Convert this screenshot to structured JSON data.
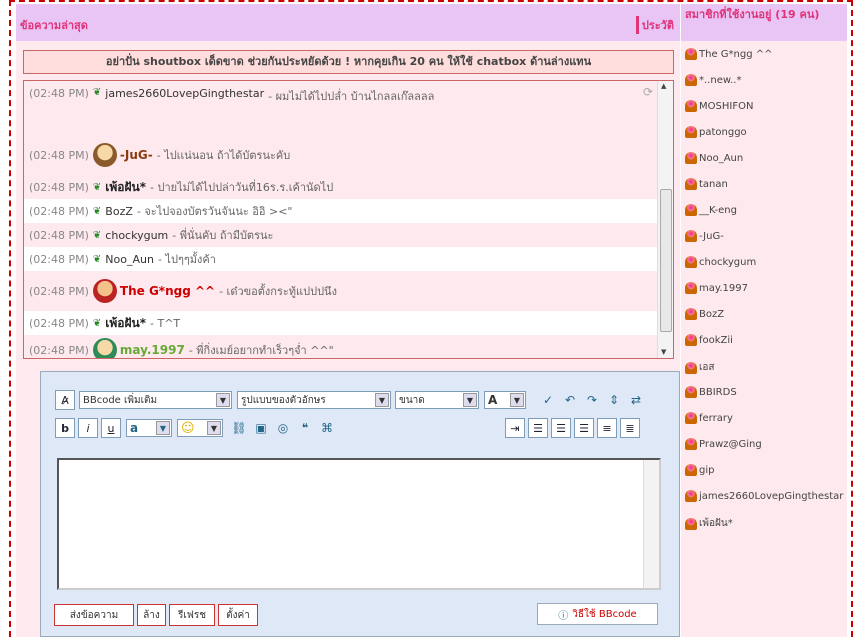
{
  "main": {
    "title": "ข้อความล่าสุด",
    "history_label": "ประวัติ",
    "notice": "อย่าปั่น shoutbox เด็ดขาด ช่วยกันประหยัดด้วย ! หากคุยเกิน 20 คน ให้ใช้ chatbox ด้านล่างแทน"
  },
  "chat": [
    {
      "time": "(02:48 PM)",
      "name": "james2660LovepGingthestar",
      "msg": "- ผมไม่ได้ไปปล่ำ บ้านไกลลเก๊ลลลล",
      "avatar": false,
      "bold": false,
      "color": "#333"
    },
    {
      "time": "(02:48 PM)",
      "name": "-JuG-",
      "msg": "- ไปเเน่นอน ถ้าได้บัตรนะคับ",
      "avatar": true,
      "bold": true,
      "color": "#8b3a10"
    },
    {
      "time": "(02:48 PM)",
      "name": "เพ้อฝัน*",
      "msg": "- ปายไม่ได้ไปปล่าวันที่16ร.ร.เค้านัดไป",
      "avatar": false,
      "bold": true,
      "color": "#222"
    },
    {
      "time": "(02:48 PM)",
      "name": "BozZ",
      "msg": "- จะไปจองบัตรวันจันนะ อิอิ ><\"",
      "avatar": false,
      "bold": false,
      "color": "#333"
    },
    {
      "time": "(02:48 PM)",
      "name": "chockygum",
      "msg": "- พี่นั่นคับ ถ้ามีบัตรนะ",
      "avatar": false,
      "bold": false,
      "color": "#333"
    },
    {
      "time": "(02:48 PM)",
      "name": "Noo_Aun",
      "msg": "- ไปๆๆมั้งค้า",
      "avatar": false,
      "bold": false,
      "color": "#333"
    },
    {
      "time": "(02:48 PM)",
      "name": "The G*ngg ^^",
      "msg": "- เด๋วขอตั้งกระทู้แปปปนึง",
      "avatar": true,
      "bold": true,
      "color": "#c00"
    },
    {
      "time": "(02:48 PM)",
      "name": "เพ้อฝัน*",
      "msg": "- T^T",
      "avatar": false,
      "bold": true,
      "color": "#222"
    },
    {
      "time": "(02:48 PM)",
      "name": "may.1997",
      "msg": "- พี่กิ่งเมย์อยากทำเร็วๆจ่ำ ^^\"",
      "avatar": true,
      "bold": true,
      "color": "#6a3"
    }
  ],
  "editor": {
    "bbcode_select": "BBcode เพิ่มเติม",
    "font_select": "รูปแบบของตัวอักษร",
    "size_select": "ขนาด",
    "buttons": {
      "send": "ส่งข้อความ",
      "clear": "ล้าง",
      "refresh": "รีเฟรช",
      "settings": "ตั้งค่า"
    },
    "help": "วิธีใช้ BBcode",
    "bold": "b",
    "italic": "i",
    "underline": "u",
    "font_color": "A",
    "smiley_color": "a"
  },
  "sidebar": {
    "title": "สมาชิกที่ใช้งานอยู่ (19 คน)",
    "members": [
      "The G*ngg ^^",
      "*..new..*",
      "MOSHIFON",
      "patonggo",
      "Noo_Aun",
      "tanan",
      "__K-eng",
      "-JuG-",
      "chockygum",
      "may.1997",
      "BozZ",
      "fookZii",
      "เอส",
      "BBIRDS",
      "ferrary",
      "Prawz@Ging",
      "gip",
      "james2660LovepGingthestar",
      "เพ้อฝัน*"
    ]
  }
}
